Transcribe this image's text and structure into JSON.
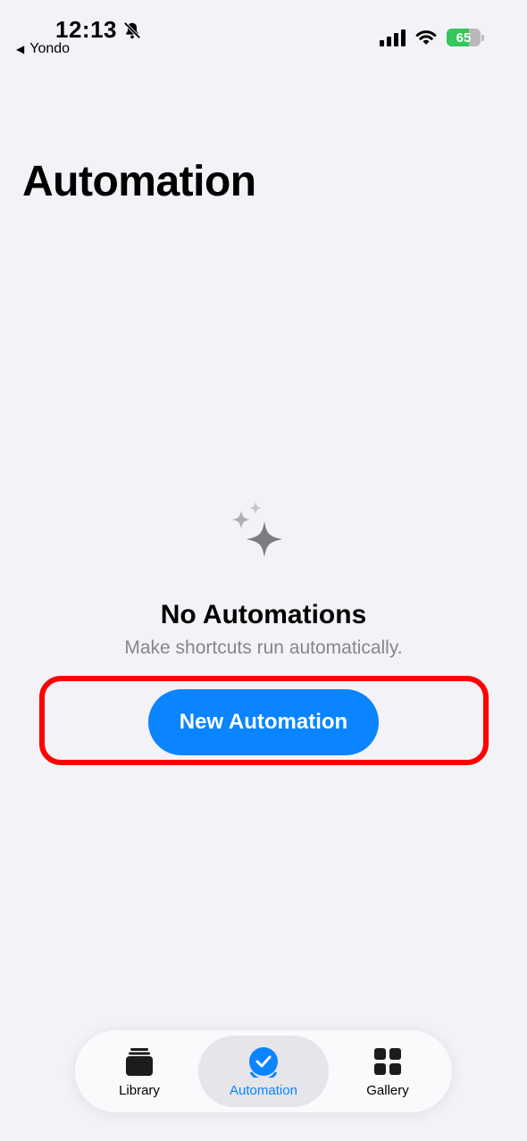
{
  "status_bar": {
    "time": "12:13",
    "back_app": "Yondo",
    "battery": "65"
  },
  "page": {
    "title": "Automation"
  },
  "empty_state": {
    "title": "No Automations",
    "subtitle": "Make shortcuts run automatically.",
    "button_label": "New Automation"
  },
  "tab_bar": {
    "tabs": [
      {
        "label": "Library",
        "icon": "library-stack-icon"
      },
      {
        "label": "Automation",
        "icon": "automation-check-icon"
      },
      {
        "label": "Gallery",
        "icon": "gallery-grid-icon"
      }
    ],
    "active": "Automation"
  },
  "colors": {
    "accent": "#0a84ff",
    "highlight": "#ff0000",
    "battery_green": "#34c759",
    "background": "#f2f2f7"
  }
}
